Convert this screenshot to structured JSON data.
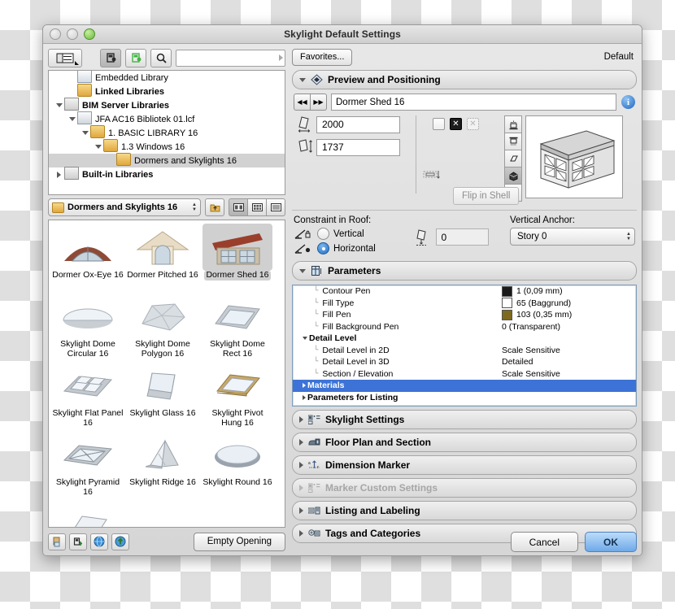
{
  "window": {
    "title": "Skylight Default Settings"
  },
  "left": {
    "toolbar": {
      "browser_icon": "list-view-icon",
      "linked_icon": "linked-library-icon",
      "embedded_icon": "embedded-library-icon",
      "search_icon": "search-icon",
      "search_value": "",
      "search_placeholder": ""
    },
    "tree": [
      {
        "label": "Embedded Library",
        "depth": 1,
        "twisty": "none",
        "icon": "embedded-library-icon",
        "bold": false,
        "selected": false
      },
      {
        "label": "Linked Libraries",
        "depth": 1,
        "twisty": "none",
        "icon": "linked-folder-icon",
        "bold": true,
        "selected": false
      },
      {
        "label": "BIM Server Libraries",
        "depth": 0,
        "twisty": "open",
        "icon": "server-library-icon",
        "bold": true,
        "selected": false
      },
      {
        "label": "JFA AC16 Bibliotek 01.lcf",
        "depth": 1,
        "twisty": "open",
        "icon": "lcf-file-icon",
        "bold": false,
        "selected": false
      },
      {
        "label": "1. BASIC LIBRARY 16",
        "depth": 2,
        "twisty": "open",
        "icon": "folder-icon",
        "bold": false,
        "selected": false
      },
      {
        "label": "1.3 Windows 16",
        "depth": 3,
        "twisty": "open",
        "icon": "folder-icon",
        "bold": false,
        "selected": false
      },
      {
        "label": "Dormers and Skylights 16",
        "depth": 4,
        "twisty": "none",
        "icon": "folder-icon",
        "bold": false,
        "selected": true
      },
      {
        "label": "Built-in Libraries",
        "depth": 0,
        "twisty": "closed",
        "icon": "builtin-library-icon",
        "bold": true,
        "selected": false
      }
    ],
    "folder_popup": {
      "label": "Dormers and Skylights 16",
      "icon": "folder-icon"
    },
    "view_buttons": [
      "up-folder-icon",
      "large-icon-view",
      "small-icon-view",
      "list-view"
    ],
    "items": [
      {
        "label": "Dormer Ox-Eye 16",
        "icon": "dormer-ox-eye",
        "selected": false
      },
      {
        "label": "Dormer Pitched 16",
        "icon": "dormer-pitched",
        "selected": false
      },
      {
        "label": "Dormer Shed 16",
        "icon": "dormer-shed",
        "selected": true
      },
      {
        "label": "Skylight Dome Circular 16",
        "icon": "skylight-dome-circular",
        "selected": false
      },
      {
        "label": "Skylight Dome Polygon 16",
        "icon": "skylight-dome-polygon",
        "selected": false
      },
      {
        "label": "Skylight Dome Rect 16",
        "icon": "skylight-dome-rect",
        "selected": false
      },
      {
        "label": "Skylight Flat Panel 16",
        "icon": "skylight-flat-panel",
        "selected": false
      },
      {
        "label": "Skylight Glass 16",
        "icon": "skylight-glass",
        "selected": false
      },
      {
        "label": "Skylight Pivot Hung 16",
        "icon": "skylight-pivot-hung",
        "selected": false
      },
      {
        "label": "Skylight Pyramid 16",
        "icon": "skylight-pyramid",
        "selected": false
      },
      {
        "label": "Skylight Ridge 16",
        "icon": "skylight-ridge",
        "selected": false
      },
      {
        "label": "Skylight Round 16",
        "icon": "skylight-round",
        "selected": false
      }
    ],
    "bottom_icons": [
      "new-object-icon",
      "duplicate-object-icon",
      "globe-icon",
      "upload-icon"
    ],
    "empty_opening_label": "Empty Opening"
  },
  "right": {
    "favorites_label": "Favorites...",
    "default_label": "Default",
    "preview_section": {
      "title": "Preview and Positioning",
      "icon": "preview-positioning-icon",
      "object_name": "Dormer Shed 16",
      "prev_icon": "previous-object-icon",
      "next_icon": "next-object-icon",
      "info_icon": "info-icon",
      "width_value": "2000",
      "width_icon": "opening-width-icon",
      "height_value": "1737",
      "height_icon": "opening-height-icon",
      "flip_label": "Flip in Shell",
      "flip_icon": "flip-in-shell-icon",
      "mirror_checkbox": "unchecked",
      "anchor_checkbox": "checked",
      "anchor_alt_checkbox": "disabled",
      "view_tools": [
        "top-view-icon",
        "bottom-view-icon",
        "2d-symbol-icon",
        "3d-view-icon",
        "section-view-icon"
      ],
      "preview_image": "dormer-shed-3d-preview"
    },
    "constraint": {
      "label": "Constraint in Roof:",
      "options": [
        {
          "label": "Vertical",
          "selected": false,
          "icon": "constraint-vertical-icon"
        },
        {
          "label": "Horizontal",
          "selected": true,
          "icon": "constraint-horizontal-icon"
        }
      ],
      "offset_value": "0",
      "offset_icon": "offset-icon",
      "vertical_anchor_label": "Vertical Anchor:",
      "vertical_anchor_value": "Story 0"
    },
    "parameters_section": {
      "title": "Parameters",
      "icon": "parameters-icon"
    },
    "parameters": [
      {
        "name": "Contour Pen",
        "value": "1 (0,09 mm)",
        "swatch": "#1a1a1a",
        "level": "leaf",
        "twisty": "none",
        "bold": false,
        "highlighted": false
      },
      {
        "name": "Fill Type",
        "value": "65 (Baggrund)",
        "swatch": "#ffffff",
        "level": "leaf",
        "twisty": "none",
        "bold": false,
        "highlighted": false
      },
      {
        "name": "Fill Pen",
        "value": "103 (0,35 mm)",
        "swatch": "#7d6a1e",
        "level": "leaf",
        "twisty": "none",
        "bold": false,
        "highlighted": false
      },
      {
        "name": "Fill Background Pen",
        "value": "0 (Transparent)",
        "swatch": null,
        "level": "leaf",
        "twisty": "none",
        "bold": false,
        "highlighted": false
      },
      {
        "name": "Detail Level",
        "value": "",
        "swatch": null,
        "level": "group",
        "twisty": "open",
        "bold": true,
        "highlighted": false
      },
      {
        "name": "Detail Level in 2D",
        "value": "Scale Sensitive",
        "swatch": null,
        "level": "leaf",
        "twisty": "none",
        "bold": false,
        "highlighted": false
      },
      {
        "name": "Detail Level in 3D",
        "value": "Detailed",
        "swatch": null,
        "level": "leaf",
        "twisty": "none",
        "bold": false,
        "highlighted": false
      },
      {
        "name": "Section / Elevation",
        "value": "Scale Sensitive",
        "swatch": null,
        "level": "leaf",
        "twisty": "none",
        "bold": false,
        "highlighted": false
      },
      {
        "name": "Materials",
        "value": "",
        "swatch": null,
        "level": "group",
        "twisty": "closed",
        "bold": true,
        "highlighted": true
      },
      {
        "name": "Parameters for Listing",
        "value": "",
        "swatch": null,
        "level": "group",
        "twisty": "closed",
        "bold": true,
        "highlighted": false
      }
    ],
    "sections": [
      {
        "title": "Skylight Settings",
        "icon": "skylight-settings-icon",
        "disabled": false
      },
      {
        "title": "Floor Plan and Section",
        "icon": "floor-plan-section-icon",
        "disabled": false
      },
      {
        "title": "Dimension Marker",
        "icon": "dimension-marker-icon",
        "disabled": false
      },
      {
        "title": "Marker Custom Settings",
        "icon": "marker-custom-settings-icon",
        "disabled": true
      },
      {
        "title": "Listing and Labeling",
        "icon": "listing-labeling-icon",
        "disabled": false
      },
      {
        "title": "Tags and Categories",
        "icon": "tags-categories-icon",
        "disabled": false
      }
    ],
    "cancel_label": "Cancel",
    "ok_label": "OK"
  },
  "colors": {
    "selection_blue": "#3d73d6",
    "default_button": "#6fa9e8",
    "tree_selection": "#d2d2d2"
  }
}
